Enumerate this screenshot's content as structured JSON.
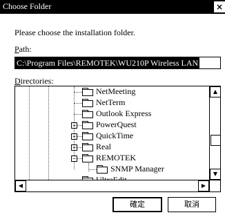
{
  "window": {
    "title": "Choose Folder",
    "close_glyph": "×"
  },
  "prompt": "Please choose the installation folder.",
  "path": {
    "label_first": "P",
    "label_rest": "ath:",
    "value": "C:\\Program Files\\REMOTEK\\WU210P Wireless LAN"
  },
  "directories": {
    "label_first": "D",
    "label_rest": "irectories:",
    "items": [
      {
        "label": "NetMeeting",
        "expander": ""
      },
      {
        "label": "NetTerm",
        "expander": ""
      },
      {
        "label": "Outlook Express",
        "expander": ""
      },
      {
        "label": "PowerQuest",
        "expander": "+"
      },
      {
        "label": "QuickTime",
        "expander": "+"
      },
      {
        "label": "Real",
        "expander": "+"
      },
      {
        "label": "REMOTEK",
        "expander": "−"
      },
      {
        "label": "SNMP Manager",
        "expander": ""
      },
      {
        "label": "UltraEdit",
        "expander": ""
      }
    ]
  },
  "scroll_glyphs": {
    "up": "▲",
    "down": "▼",
    "left": "◀",
    "right": "▶"
  },
  "buttons": {
    "ok": "確定",
    "cancel": "取消"
  }
}
